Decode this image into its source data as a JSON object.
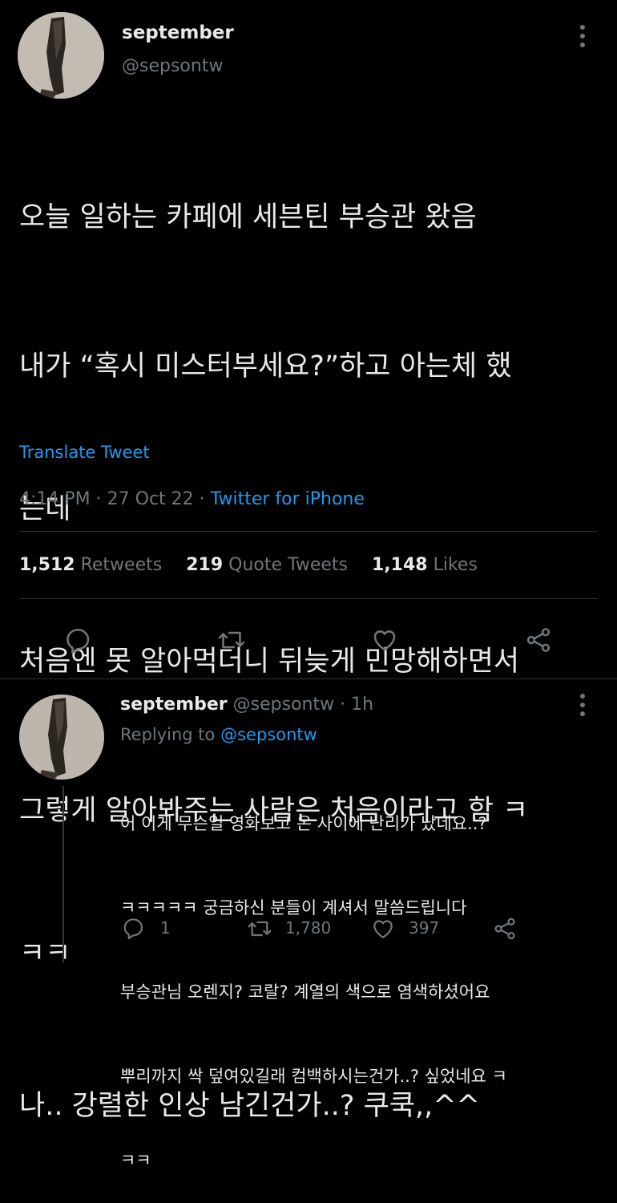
{
  "tweet": {
    "display_name": "september",
    "handle": "@sepsontw",
    "lines": [
      "오늘 일하는 카페에 세븐틴 부승관 왔음",
      "내가 “혹시 미스터부세요?”하고 아는체 했",
      "는데",
      "처음엔 못 알아먹더니 뒤늦게 민망해하면서",
      "그렇게 알아봐주는 사람은 처음이라고 함 ㅋ",
      "ㅋㅋ",
      "나.. 강렬한 인상 남긴건가..? 쿠쿡,,^^"
    ],
    "translate": "Translate Tweet",
    "time": "4:14 PM",
    "sep1": "·",
    "date": "27 Oct 22",
    "sep2": "·",
    "source": "Twitter for iPhone",
    "retweets_count": "1,512",
    "retweets_label": "Retweets",
    "quotes_count": "219",
    "quotes_label": "Quote Tweets",
    "likes_count": "1,148",
    "likes_label": "Likes"
  },
  "reply": {
    "display_name": "september",
    "handle": "@sepsontw",
    "sep": "·",
    "age": "1h",
    "replying_to_label": "Replying to",
    "replying_to_handle": "@sepsontw",
    "lines": [
      "어 이게 무슨일 영화보고 온 사이에 난리가 났네요..?",
      "ㅋㅋㅋㅋㅋ 궁금하신 분들이 계셔서 말씀드립니다",
      "부승관님 오렌지? 코랄? 계열의 색으로 염색하셨어요",
      "뿌리까지 싹 덮여있길래 컴백하시는건가..? 싶었네요 ㅋ",
      "ㅋㅋ"
    ],
    "reply_count": "1",
    "retweet_count": "1,780",
    "like_count": "397"
  },
  "colors": {
    "background": "#000000",
    "text": "#e7e9ea",
    "muted": "#71767b",
    "link": "#1d9bf0",
    "divider": "#2f3336"
  },
  "icons": [
    "more-icon",
    "reply-icon",
    "retweet-icon",
    "like-icon",
    "share-icon"
  ]
}
